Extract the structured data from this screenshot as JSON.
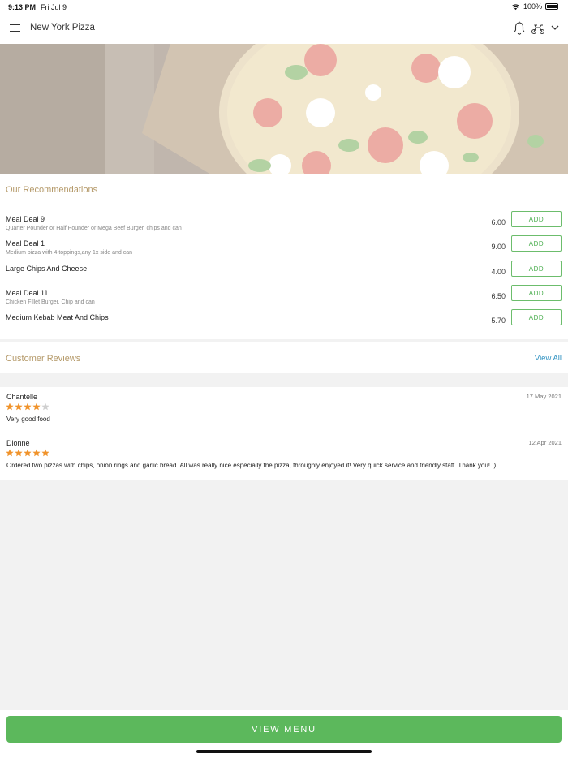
{
  "status_bar": {
    "time": "9:13 PM",
    "date": "Fri Jul 9",
    "battery": "100%"
  },
  "nav": {
    "title": "New York Pizza"
  },
  "recommendations": {
    "title": "Our Recommendations",
    "add_label": "ADD",
    "items": [
      {
        "name": "Meal Deal 9",
        "description": "Quarter Pounder or Half Pounder or Mega Beef Burger, chips and can",
        "price": "6.00"
      },
      {
        "name": "Meal Deal 1",
        "description": "Medium pizza with 4 toppings,any 1x side and can",
        "price": "9.00"
      },
      {
        "name": "Large Chips And Cheese",
        "description": "",
        "price": "4.00"
      },
      {
        "name": "Meal Deal 11",
        "description": "Chicken Fillet Burger, Chip and can",
        "price": "6.50"
      },
      {
        "name": "Medium Kebab Meat And Chips",
        "description": "",
        "price": "5.70"
      }
    ]
  },
  "reviews": {
    "title": "Customer Reviews",
    "view_all": "View All",
    "items": [
      {
        "author": "Chantelle",
        "date": "17 May 2021",
        "rating": 4,
        "text": "Very good food"
      },
      {
        "author": "Dionne",
        "date": "12 Apr 2021",
        "rating": 5,
        "text": "Ordered two pizzas with chips, onion rings and garlic bread. All was really nice especially the pizza, throughly enjoyed it! Very quick service and friendly staff. Thank you! :)"
      }
    ]
  },
  "footer": {
    "view_menu_label": "VIEW MENU"
  },
  "colors": {
    "accent_green": "#5cb85c",
    "section_title": "#b59a6a",
    "link_blue": "#2a8fc0",
    "star_orange": "#f0932b"
  }
}
